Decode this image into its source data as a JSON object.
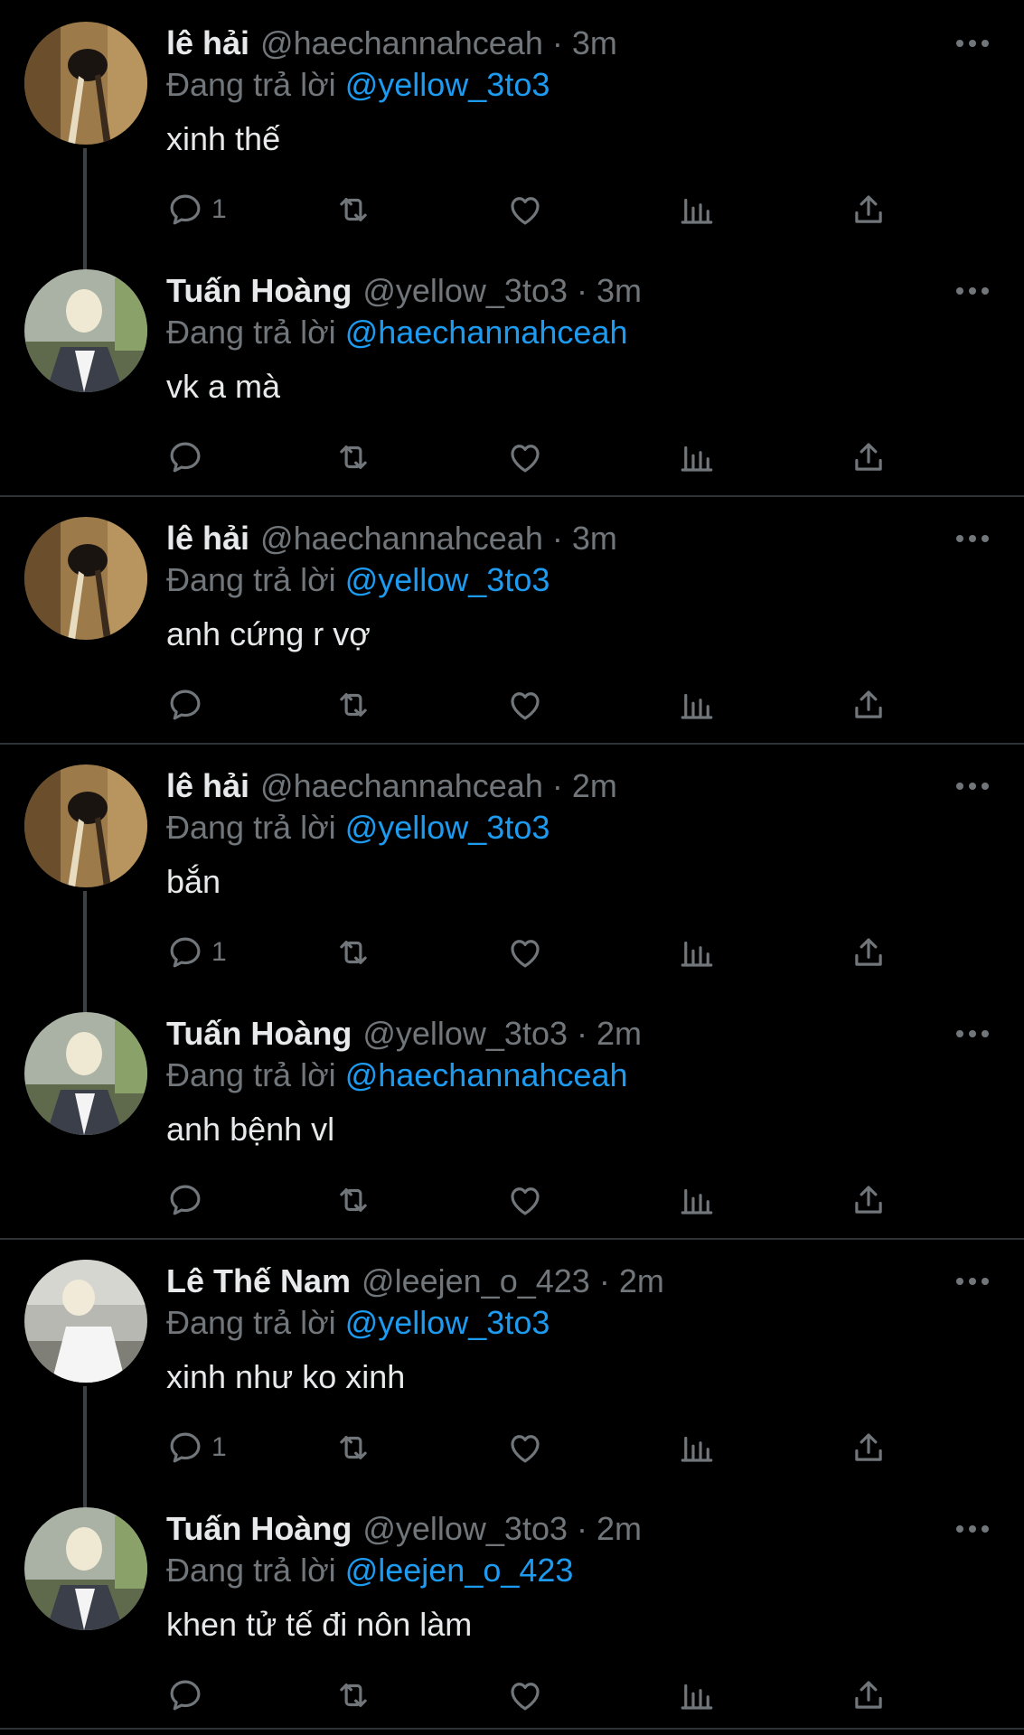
{
  "replying_prefix": "Đang trả lời",
  "colors": {
    "background": "#000000",
    "name": "#e7e9ea",
    "secondary": "#71767b",
    "link": "#1d9bf0",
    "divider": "#2f3336"
  },
  "tweets": [
    {
      "name": "lê hải",
      "handle": "@haechannahceah",
      "time": "3m",
      "dot": "·",
      "replying_to": "@yellow_3to3",
      "text": "xinh thế",
      "reply_count": "1",
      "avatar": "avatar-haechan"
    },
    {
      "name": "Tuấn Hoàng",
      "handle": "@yellow_3to3",
      "time": "3m",
      "dot": "·",
      "replying_to": "@haechannahceah",
      "text": "vk a mà",
      "reply_count": "",
      "avatar": "avatar-yellow"
    },
    {
      "name": "lê hải",
      "handle": "@haechannahceah",
      "time": "3m",
      "dot": "·",
      "replying_to": "@yellow_3to3",
      "text": "anh cứng r vợ",
      "reply_count": "",
      "avatar": "avatar-haechan"
    },
    {
      "name": "lê hải",
      "handle": "@haechannahceah",
      "time": "2m",
      "dot": "·",
      "replying_to": "@yellow_3to3",
      "text": "bắn",
      "reply_count": "1",
      "avatar": "avatar-haechan"
    },
    {
      "name": "Tuấn Hoàng",
      "handle": "@yellow_3to3",
      "time": "2m",
      "dot": "·",
      "replying_to": "@haechannahceah",
      "text": "anh bệnh vl",
      "reply_count": "",
      "avatar": "avatar-yellow"
    },
    {
      "name": "Lê Thế Nam",
      "handle": "@leejen_o_423",
      "time": "2m",
      "dot": "·",
      "replying_to": "@yellow_3to3",
      "text": "xinh như ko xinh",
      "reply_count": "1",
      "avatar": "avatar-leejen"
    },
    {
      "name": "Tuấn Hoàng",
      "handle": "@yellow_3to3",
      "time": "2m",
      "dot": "·",
      "replying_to": "@leejen_o_423",
      "text": "khen tử tế đi nôn làm",
      "reply_count": "",
      "avatar": "avatar-yellow"
    }
  ],
  "icons": {
    "reply": "reply-icon",
    "retweet": "retweet-icon",
    "like": "like-icon",
    "views": "views-icon",
    "share": "share-icon",
    "more": "more-icon"
  }
}
